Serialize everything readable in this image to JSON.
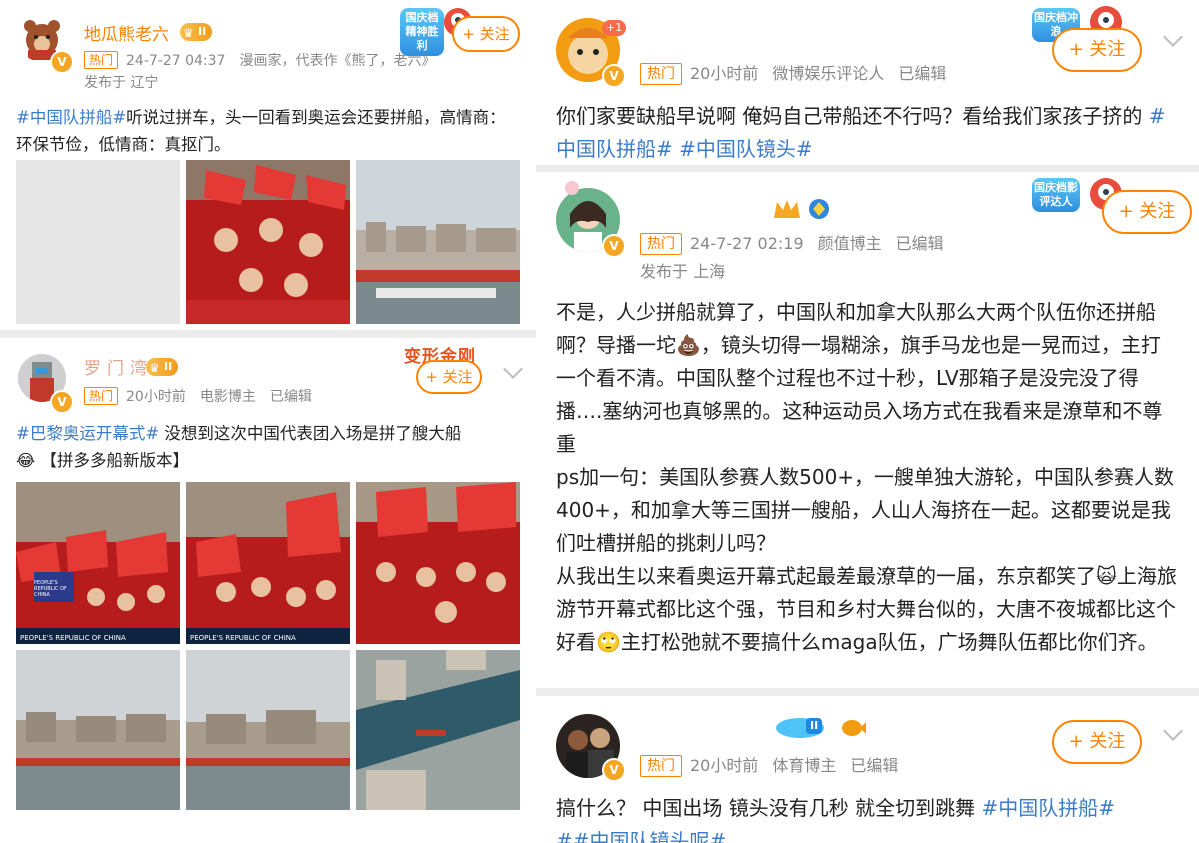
{
  "post1": {
    "username": "地瓜熊老六",
    "level": "II",
    "meta_hot": "热门",
    "meta_time": "24-7-27 04:37",
    "meta_desc": "漫画家，代表作《熊了，老六》",
    "location": "发布于 辽宁",
    "follow": "+ 关注",
    "deco_label": "国庆档精神胜利",
    "text_tag": "#中国队拼船#",
    "text_body": "听说过拼车，头一回看到奥运会还要拼船，高情商：环保节俭，低情商：真抠门。"
  },
  "post2": {
    "username": "罗门湾",
    "level": "II",
    "meta_hot": "热门",
    "meta_time": "20小时前",
    "meta_role": "电影博主",
    "meta_edit": "已编辑",
    "follow": "+ 关注",
    "deco_label": "变形金刚",
    "text_tag": "#巴黎奥运开幕式#",
    "text_body": " 没想到这次中国代表团入场是拼了艘大船",
    "text_line2": "😂 【拼多多船新版本】",
    "caption": "PEOPLE'S REPUBLIC OF CHINA",
    "flag_label": "PEOPLE'S REPUBLIC OF CHINA"
  },
  "post3": {
    "avatar_badge": "+1",
    "meta_hot": "热门",
    "meta_time": "20小时前",
    "meta_role": "微博娱乐评论人",
    "meta_edit": "已编辑",
    "follow": "+ 关注",
    "deco_label": "国庆档冲浪",
    "text_body": "你们家要缺船早说啊 俺妈自己带船还不行吗？看给我们家孩子挤的 ",
    "tag1": "#中国队拼船#",
    "tag2": " #中国队镜头#"
  },
  "post4": {
    "meta_hot": "热门",
    "meta_time": "24-7-27 02:19",
    "meta_role": "颜值博主",
    "meta_edit": "已编辑",
    "location": "发布于 上海",
    "follow": "+ 关注",
    "deco_label": "国庆档影评达人",
    "p1": "不是，人少拼船就算了，中国队和加拿大队那么大两个队伍你还拼船啊？导播一坨💩，镜头切得一塌糊涂，旗手马龙也是一晃而过，主打一个看不清。中国队整个过程也不过十秒，LV那箱子是没完没了得播….塞纳河也真够黑的。这种运动员入场方式在我看来是潦草和不尊重",
    "p2": "ps加一句：美国队参赛人数500+，一艘单独大游轮，中国队参赛人数400+，和加拿大等三国拼一艘船，人山人海挤在一起。这都要说是我们吐槽拼船的挑刺儿吗？",
    "p3": "从我出生以来看奥运开幕式起最差最潦草的一届，东京都笑了🙀上海旅游节开幕式都比这个强，节目和乡村大舞台似的，大唐不夜城都比这个好看🙄主打松弛就不要搞什么maga队伍，广场舞队伍都比你们齐。"
  },
  "post5": {
    "level": "II",
    "meta_hot": "热门",
    "meta_time": "20小时前",
    "meta_role": "体育博主",
    "meta_edit": "已编辑",
    "follow": "+ 关注",
    "text_body": "搞什么？ 中国出场 镜头没有几秒 就全切到跳舞 ",
    "tag1": "#中国队拼船#",
    "tag2": "##中国队镜头呢#"
  },
  "colors": {
    "accent": "#ff8200",
    "link": "#3b7cc9",
    "badge": "#f5a623"
  }
}
